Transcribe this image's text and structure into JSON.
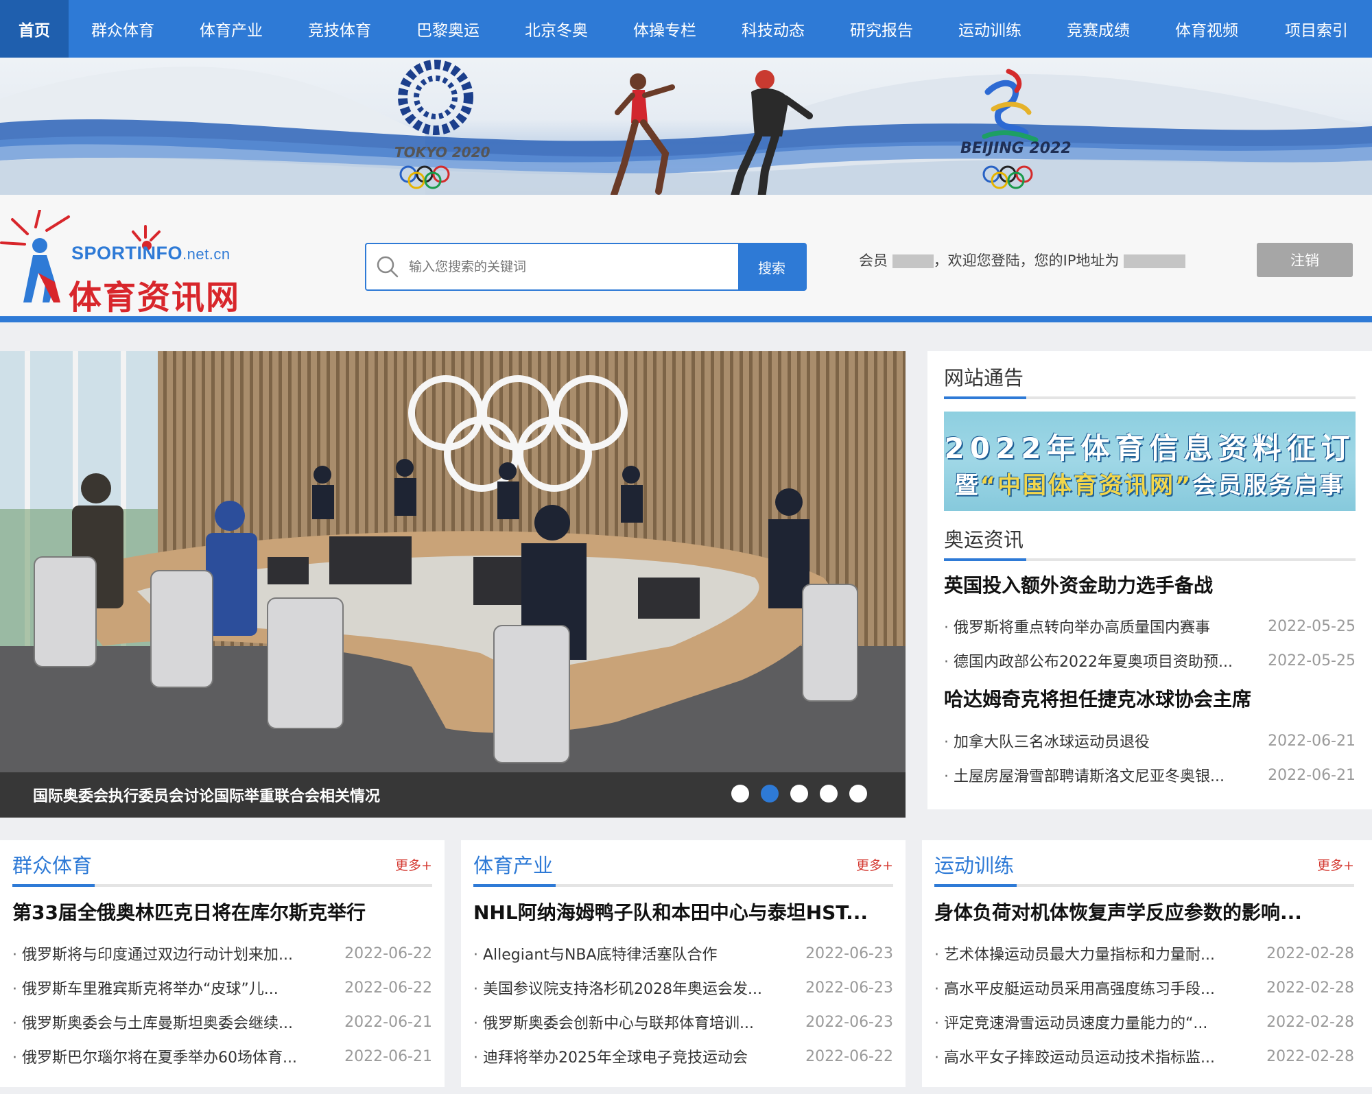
{
  "nav": {
    "items": [
      "首页",
      "群众体育",
      "体育产业",
      "竞技体育",
      "巴黎奥运",
      "北京冬奥",
      "体操专栏",
      "科技动态",
      "研究报告",
      "运动训练",
      "竞赛成绩",
      "体育视频",
      "项目索引"
    ],
    "active_index": 0
  },
  "banner": {
    "left_logo_text": "TOKYO 2020",
    "right_logo_text": "BEIJING 2022"
  },
  "header": {
    "logo_en": "SPORTINFO",
    "logo_domain": ".net.cn",
    "logo_cn": "体育资讯网",
    "search_placeholder": "输入您搜索的关键词",
    "search_button": "搜索",
    "welcome_prefix": "会员",
    "welcome_middle": "，欢迎您登陆，您的IP地址为",
    "logout_button": "注销"
  },
  "hero": {
    "caption": "国际奥委会执行委员会讨论国际举重联合会相关情况",
    "slide_count": 5,
    "active_slide": 1
  },
  "sidebar": {
    "notice_title": "网站通告",
    "notice_image_line1": "2022年体育信息资料征订",
    "notice_image_line2_prefix": "暨",
    "notice_image_line2_highlight": "“中国体育资讯网”",
    "notice_image_line2_suffix": "会员服务启事",
    "olympic_title": "奥运资讯",
    "headline1": "英国投入额外资金助力选手备战",
    "list1": [
      {
        "title": "俄罗斯将重点转向举办高质量国内赛事",
        "date": "2022-05-25"
      },
      {
        "title": "德国内政部公布2022年夏奥项目资助预...",
        "date": "2022-05-25"
      }
    ],
    "headline2": "哈达姆奇克将担任捷克冰球协会主席",
    "list2": [
      {
        "title": "加拿大队三名冰球运动员退役",
        "date": "2022-06-21"
      },
      {
        "title": "土屋房屋滑雪部聘请斯洛文尼亚冬奥银...",
        "date": "2022-06-21"
      }
    ]
  },
  "columns": [
    {
      "title": "群众体育",
      "more": "更多+",
      "headline": "第33届全俄奥林匹克日将在库尔斯克举行",
      "items": [
        {
          "title": "俄罗斯将与印度通过双边行动计划来加...",
          "date": "2022-06-22"
        },
        {
          "title": "俄罗斯车里雅宾斯克将举办“皮球”儿...",
          "date": "2022-06-22"
        },
        {
          "title": "俄罗斯奥委会与土库曼斯坦奥委会继续...",
          "date": "2022-06-21"
        },
        {
          "title": "俄罗斯巴尔瑙尔将在夏季举办60场体育...",
          "date": "2022-06-21"
        }
      ]
    },
    {
      "title": "体育产业",
      "more": "更多+",
      "headline": "NHL阿纳海姆鸭子队和本田中心与泰坦HST...",
      "items": [
        {
          "title": "Allegiant与NBA底特律活塞队合作",
          "date": "2022-06-23"
        },
        {
          "title": "美国参议院支持洛杉矶2028年奥运会发...",
          "date": "2022-06-23"
        },
        {
          "title": "俄罗斯奥委会创新中心与联邦体育培训...",
          "date": "2022-06-23"
        },
        {
          "title": "迪拜将举办2025年全球电子竞技运动会",
          "date": "2022-06-22"
        }
      ]
    },
    {
      "title": "运动训练",
      "more": "更多+",
      "headline": "身体负荷对机体恢复声学反应参数的影响...",
      "items": [
        {
          "title": "艺术体操运动员最大力量指标和力量耐...",
          "date": "2022-02-28"
        },
        {
          "title": "高水平皮艇运动员采用高强度练习手段...",
          "date": "2022-02-28"
        },
        {
          "title": "评定竞速滑雪运动员速度力量能力的“...",
          "date": "2022-02-28"
        },
        {
          "title": "高水平女子摔跤运动员运动技术指标监...",
          "date": "2022-02-28"
        }
      ]
    }
  ],
  "colors": {
    "brand_blue": "#2e7ad6",
    "active_nav": "#1f5fae",
    "logo_red": "#d8262b",
    "more_red": "#d43a32"
  }
}
